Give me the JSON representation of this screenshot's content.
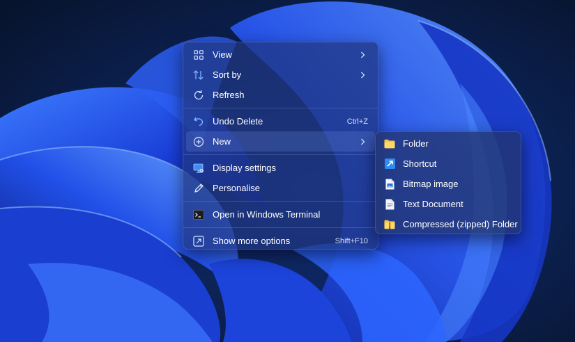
{
  "colors": {
    "menu_bg": "#203680",
    "text": "#ffffff",
    "accent_icon": "#7fb4ff",
    "folder_yellow": "#f5c543"
  },
  "context_menu": {
    "items": [
      {
        "label": "View",
        "icon": "grid-icon",
        "has_submenu": true
      },
      {
        "label": "Sort by",
        "icon": "sort-arrows-icon",
        "has_submenu": true
      },
      {
        "label": "Refresh",
        "icon": "refresh-icon"
      },
      {
        "label": "Undo Delete",
        "icon": "undo-icon",
        "shortcut": "Ctrl+Z"
      },
      {
        "label": "New",
        "icon": "plus-circle-icon",
        "has_submenu": true,
        "highlighted": true
      },
      {
        "label": "Display settings",
        "icon": "display-settings-icon"
      },
      {
        "label": "Personalise",
        "icon": "pen-icon"
      },
      {
        "label": "Open in Windows Terminal",
        "icon": "terminal-icon"
      },
      {
        "label": "Show more options",
        "icon": "more-options-icon",
        "shortcut": "Shift+F10"
      }
    ]
  },
  "new_submenu": {
    "items": [
      {
        "label": "Folder",
        "icon": "folder-icon"
      },
      {
        "label": "Shortcut",
        "icon": "shortcut-icon"
      },
      {
        "label": "Bitmap image",
        "icon": "bitmap-file-icon"
      },
      {
        "label": "Text Document",
        "icon": "text-file-icon"
      },
      {
        "label": "Compressed (zipped) Folder",
        "icon": "zip-folder-icon"
      }
    ]
  }
}
